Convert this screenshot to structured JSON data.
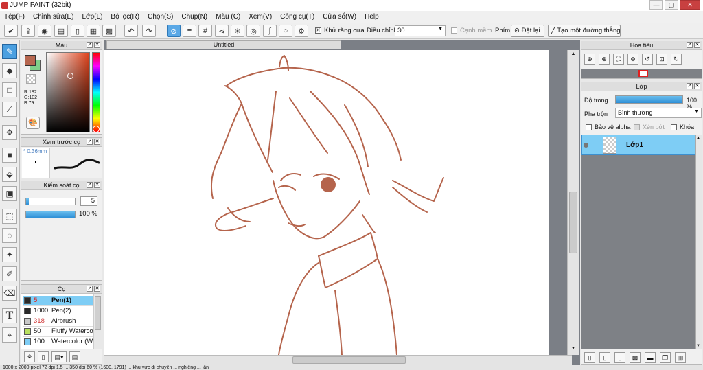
{
  "window": {
    "title": "JUMP PAINT (32bit)",
    "minimize": "—",
    "maximize": "▢",
    "close": "✕"
  },
  "menu": [
    "Tệp(F)",
    "Chỉnh sửa(E)",
    "Lớp(L)",
    "Bộ lọc(R)",
    "Chọn(S)",
    "Chụp(N)",
    "Màu (C)",
    "Xem(V)",
    "Công cụ(T)",
    "Cửa sổ(W)",
    "Help"
  ],
  "toolbar": {
    "antialias_label": "Khử răng cưa",
    "adjust_label": "Điều chỉnh",
    "adjust_value": "30",
    "canh_mem_label": "Cạnh mềm",
    "phim_label": "Phím",
    "reset_label": "Đặt lại",
    "line_label": "Tạo một đường thẳng"
  },
  "color_panel": {
    "title": "Màu",
    "r": "R:182",
    "g": "G:102",
    "b": "B:79",
    "main_color": "#b6664f",
    "sub_color": "#7fd08a"
  },
  "preview_panel": {
    "title": "Xem trước cọ",
    "size": "* 0.36mm"
  },
  "brush_control_panel": {
    "title": "Kiểm soát cọ",
    "size_value": "5",
    "opacity_value": "100 %",
    "opacity_level": 1.0,
    "size_level": 0.05
  },
  "brush_panel": {
    "title": "Cọ",
    "items": [
      {
        "num": "5",
        "name": "Pen(1)",
        "color": "#2a2a2a",
        "selected": true,
        "num_color": "#d23a3a"
      },
      {
        "num": "1000",
        "name": "Pen(2)",
        "color": "#2a2a2a",
        "selected": false,
        "num_color": "#111111"
      },
      {
        "num": "318",
        "name": "Airbrush",
        "color": "#c8c8c8",
        "selected": false,
        "num_color": "#d23a3a"
      },
      {
        "num": "50",
        "name": "Fluffy Waterco",
        "color": "#b8e060",
        "selected": false,
        "num_color": "#111111"
      },
      {
        "num": "100",
        "name": "Watercolor (W",
        "color": "#7ecdf5",
        "selected": false,
        "num_color": "#111111"
      }
    ]
  },
  "document": {
    "tab": "Untitled"
  },
  "navigator_panel": {
    "title": "Hoa tiêu"
  },
  "layer_panel": {
    "title": "Lớp",
    "opacity_label": "Độ trong",
    "opacity_value": "100 %",
    "opacity_level": 1.0,
    "blend_label": "Pha trộn",
    "blend_value": "Bình thường",
    "protect_alpha": "Bảo vệ alpha",
    "clip": "Xén bớt",
    "lock": "Khóa",
    "layers": [
      {
        "name": "Lớp1"
      }
    ]
  },
  "status": "1000 x 2000 pixel 72 dpi 1.5 ... 350 dpi 60 % (1600, 1791) ... khu vực di chuyển ... nghiêng ... lẫn"
}
